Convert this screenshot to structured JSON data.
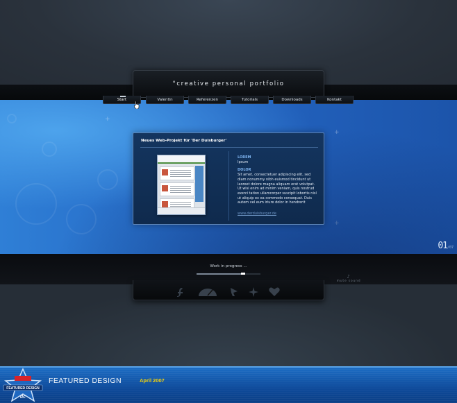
{
  "site": {
    "title": "creative personal portfolio",
    "title_mark": "°"
  },
  "nav": {
    "items": [
      {
        "label": "Start",
        "active": true
      },
      {
        "label": "Valentin",
        "active": false
      },
      {
        "label": "Referenzen",
        "active": false
      },
      {
        "label": "Tutorials",
        "active": false
      },
      {
        "label": "Downloads",
        "active": false
      },
      {
        "label": "Kontakt",
        "active": false
      }
    ]
  },
  "panel": {
    "title": "Neues Web-Projekt für 'Der Duisburger'",
    "lorem_heading": "LOREM",
    "lorem_text": "Ipsum",
    "dolor_heading": "DOLOR",
    "dolor_text": "Sit amet, consectetuer adipiscing elit, sed diam nonummy nibh euismod tincidunt ut laoreet dolore magna aliquam erat volutpat. Ut wisi enim ad minim veniam, quis nostrud exerci tation ullamcorper suscipit lobortis nisl ut aliquip ex ea commodo consequat. Duis autem vel eum iriure dolor in hendrerit",
    "link": "www.derduisburger.de"
  },
  "counter": {
    "value": "01",
    "suffix": "/07"
  },
  "player": {
    "status": "Work in progress ...",
    "progress": 0.73,
    "mute_label": "mute sound"
  },
  "feature": {
    "title": "FEATURED DESIGN",
    "date": "April 2007",
    "badge_text": "FEATURED DESIGN",
    "badge_mark": "dc"
  },
  "colors": {
    "stage_blue": "#2466c3",
    "accent_yellow": "#f4d20a",
    "panel_bg": "#14355f"
  },
  "icons": [
    "flash-icon",
    "speedometer-icon",
    "play-arrow-icon",
    "sparkle-icon",
    "heart-icon"
  ]
}
